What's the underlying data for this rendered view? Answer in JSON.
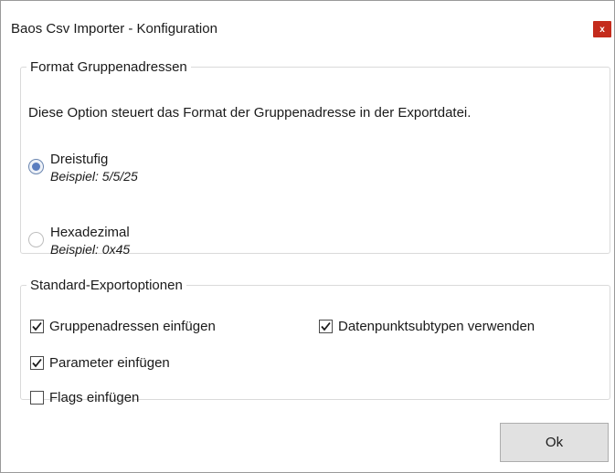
{
  "window": {
    "title": "Baos Csv Importer - Konfiguration",
    "close_label": "x"
  },
  "format_group": {
    "legend": "Format Gruppenadressen",
    "description": "Diese Option steuert das Format der Gruppenadresse in der Exportdatei.",
    "options": [
      {
        "label": "Dreistufig",
        "example": "Beispiel: 5/5/25",
        "selected": true
      },
      {
        "label": "Hexadezimal",
        "example": "Beispiel: 0x45",
        "selected": false
      }
    ]
  },
  "export_group": {
    "legend": "Standard-Exportoptionen",
    "options": [
      {
        "label": "Gruppenadressen einfügen",
        "checked": true
      },
      {
        "label": "Parameter einfügen",
        "checked": true
      },
      {
        "label": "Flags einfügen",
        "checked": false
      },
      {
        "label": "Datenpunktsubtypen verwenden",
        "checked": true
      }
    ]
  },
  "buttons": {
    "ok_label": "Ok"
  },
  "colors": {
    "close_button": "#c42b1c",
    "radio_selected": "#5a7dbf"
  },
  "icons": {
    "close": "close-icon",
    "check": "checkmark-icon"
  }
}
